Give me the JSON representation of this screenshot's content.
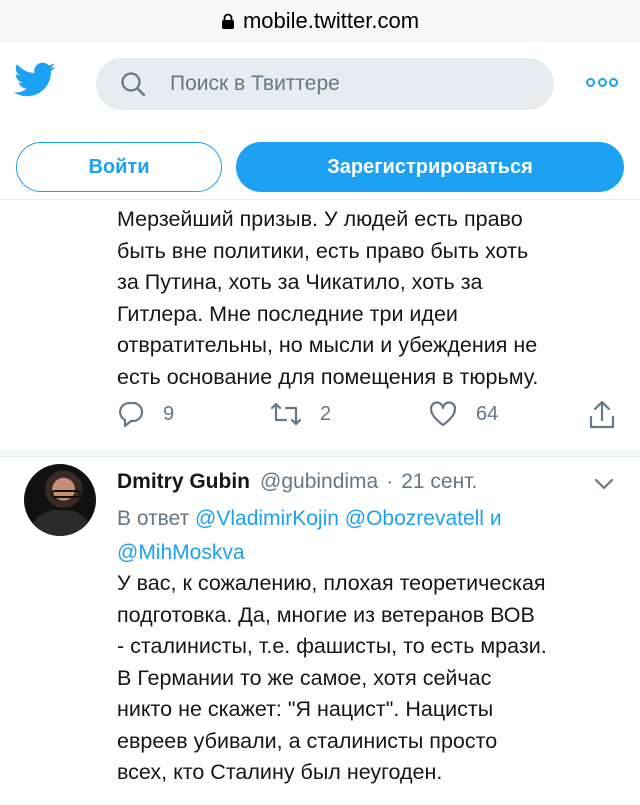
{
  "browser": {
    "url": "mobile.twitter.com"
  },
  "header": {
    "search_placeholder": "Поиск в Твиттере",
    "login_label": "Войти",
    "signup_label": "Зарегистрироваться"
  },
  "tweet1": {
    "lines": [
      "Мерзейший призыв. У людей есть право",
      "быть вне политики, есть право быть хоть",
      "за Путина, хоть за Чикатило, хоть за",
      "Гитлера. Мне последние три идеи",
      "отвратительны, но мысли и убеждения не",
      "есть основание для помещения в тюрьму."
    ],
    "replies": "9",
    "retweets": "2",
    "likes": "64"
  },
  "tweet2": {
    "display_name": "Dmitry Gubin",
    "handle": "@gubindima",
    "separator": "·",
    "date": "21 сент.",
    "reply_prefix": "В ответ",
    "mentions": [
      "@VladimirKojin",
      "@Obozrevatell",
      "@MihMoskva"
    ],
    "reply_and": "и",
    "lines": [
      "У вас, к сожалению, плохая теоретическая",
      "подготовка. Да, многие из ветеранов ВОВ",
      "- сталинисты, т.е. фашисты, то есть мрази.",
      "В Германии то же самое, хотя сейчас",
      "никто не скажет: \"Я нацист\". Нацисты",
      "евреев убивали, а сталинисты просто",
      "всех, кто Сталину был неугоден."
    ]
  },
  "colors": {
    "accent": "#1da1f2",
    "secondary": "#657786",
    "text": "#14171a"
  }
}
